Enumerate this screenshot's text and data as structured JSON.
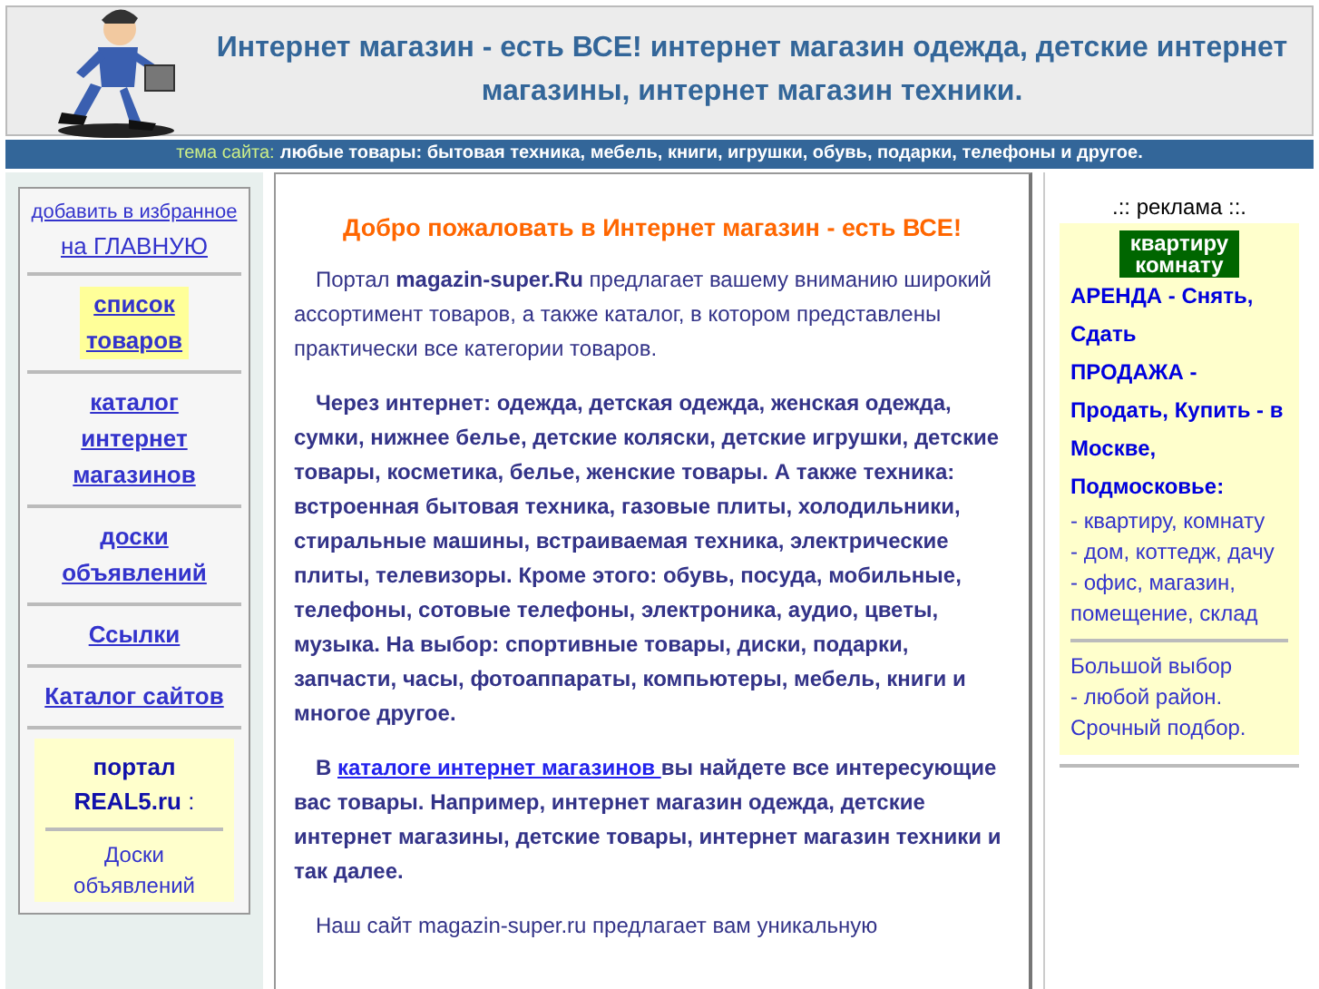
{
  "header": {
    "title": "Интернет магазин - есть ВСЕ! интернет магазин одежда, детские интернет магазины, интернет магазин техники."
  },
  "topic_bar": {
    "label": "тема сайта:",
    "text": "любые товары: бытовая техника, мебель, книги, игрушки, обувь, подарки, телефоны и другое."
  },
  "sidebar": {
    "favorite_link": "добавить в избранное",
    "home_link": "на ГЛАВНУЮ",
    "items": [
      {
        "label": "список товаров",
        "highlighted": true
      },
      {
        "label": "каталог интернет магазинов",
        "highlighted": false
      },
      {
        "label": "доски объявлений",
        "highlighted": false
      },
      {
        "label": "Ссылки",
        "highlighted": false
      },
      {
        "label": "Каталог сайтов",
        "highlighted": false
      }
    ],
    "portal": {
      "title": "портал",
      "name": "REAL5.ru",
      "suffix": ":",
      "text": "Доски объявлений"
    }
  },
  "content": {
    "heading": "Добро пожаловать в Интернет магазин - есть ВСЕ!",
    "paragraphs": [
      {
        "kind": "plain",
        "text": "Портал **magazin-super.Ru** предлагает вашему вниманию широкий ассортимент товаров, а также каталог, в котором представлены практически все категории товаров."
      },
      {
        "kind": "bold",
        "text": "Через интернет: одежда, детская одежда, женская одежда, сумки, нижнее белье, детские коляски, детские игрушки, детские товары, косметика, белье, женские товары. А также техника: встроенная бытовая техника, газовые плиты, холодильники, стиральные машины, встраиваемая техника, электрические плиты, телевизоры. Кроме этого: обувь, посуда, мобильные, телефоны, сотовые телефоны, электроника, аудио, цветы, музыка. На выбор: спортивные товары, диски, подарки, запчасти, часы, фотоаппараты, компьютеры, мебель, книги и многое другое."
      },
      {
        "kind": "link",
        "before": "В ",
        "link": "каталоге интернет магазинов ",
        "after": "вы найдете все интересующие вас товары. Например, интернет магазин одежда, детские интернет магазины, детские товары, интернет магазин техники и так далее."
      },
      {
        "kind": "plain",
        "text": "Наш сайт magazin-super.ru предлагает вам уникальную"
      }
    ]
  },
  "ad": {
    "caption": ".:: реклама ::.",
    "badge": [
      "квартиру",
      "комнату"
    ],
    "headline": [
      "**АРЕНДА - Снять, Сдать**",
      "**ПРОДАЖА - Продать, Купить - в Москве, Подмосковье**:"
    ],
    "list": [
      "- квартиру, комнату",
      "- дом, коттедж, дачу",
      "- офис, магазин, помещение, склад"
    ],
    "footer": [
      "Большой выбор",
      "- любой район.",
      "Срочный подбор."
    ]
  }
}
